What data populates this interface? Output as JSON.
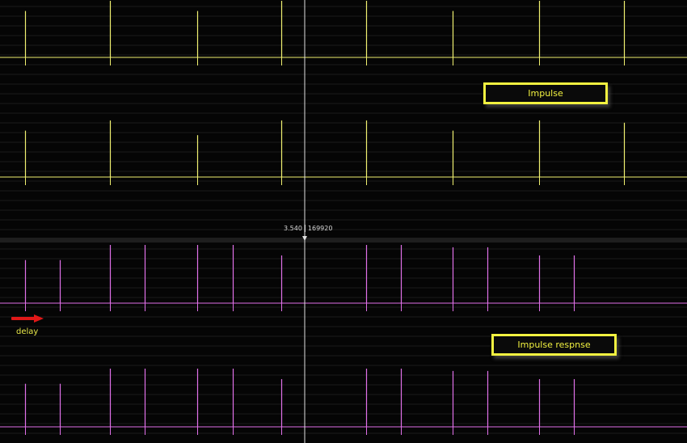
{
  "annotations": {
    "impulse_label": "Impulse",
    "response_label": "Impulse respnse",
    "delay_label": "delay"
  },
  "cursor": {
    "time": "3.540",
    "sample": "169920"
  },
  "colors": {
    "impulse_trace": "#f0f070",
    "response_trace": "#e070e8",
    "cursor": "#e0e0e0",
    "gridline": "#1a1a1a",
    "divider": "#1e1e1e",
    "box_border": "#f2f240",
    "arrow": "#e01818"
  },
  "icons": {
    "delay_arrow": "arrow-right-icon",
    "cursor_handle": "cursor-handle-icon"
  },
  "tracks": [
    {
      "name": "impulse-track-left",
      "group": "impulse",
      "pulse_times": [
        0.1,
        0.73,
        1.38,
        2.0,
        2.63,
        3.27,
        3.91,
        4.54
      ],
      "pulse_levels": [
        0.82,
        1.0,
        0.82,
        1.0,
        1.0,
        0.82,
        1.0,
        1.0
      ]
    },
    {
      "name": "impulse-track-right",
      "group": "impulse",
      "pulse_times": [
        0.1,
        0.73,
        1.38,
        2.0,
        2.63,
        3.27,
        3.91,
        4.54
      ],
      "pulse_levels": [
        0.82,
        1.0,
        0.74,
        1.0,
        1.0,
        0.82,
        1.0,
        0.96
      ]
    },
    {
      "name": "response-track-left",
      "group": "response",
      "pulse_times": [
        0.1,
        0.36,
        0.73,
        0.99,
        1.38,
        1.64,
        2.0,
        2.63,
        2.89,
        3.27,
        3.53,
        3.91,
        4.17
      ],
      "pulse_levels": [
        0.74,
        0.74,
        1.0,
        1.0,
        1.0,
        1.0,
        0.82,
        1.0,
        1.0,
        0.96,
        0.96,
        0.82,
        0.82
      ]
    },
    {
      "name": "response-track-right",
      "group": "response",
      "pulse_times": [
        0.1,
        0.36,
        0.73,
        0.99,
        1.38,
        1.64,
        2.0,
        2.63,
        2.89,
        3.27,
        3.53,
        3.91,
        4.17
      ],
      "pulse_levels": [
        0.74,
        0.74,
        1.0,
        1.0,
        1.0,
        1.0,
        0.82,
        1.0,
        1.0,
        0.96,
        0.96,
        0.82,
        0.82
      ]
    }
  ],
  "timeline": {
    "view_start_seconds": 0.0,
    "view_end_seconds": 5.0
  }
}
